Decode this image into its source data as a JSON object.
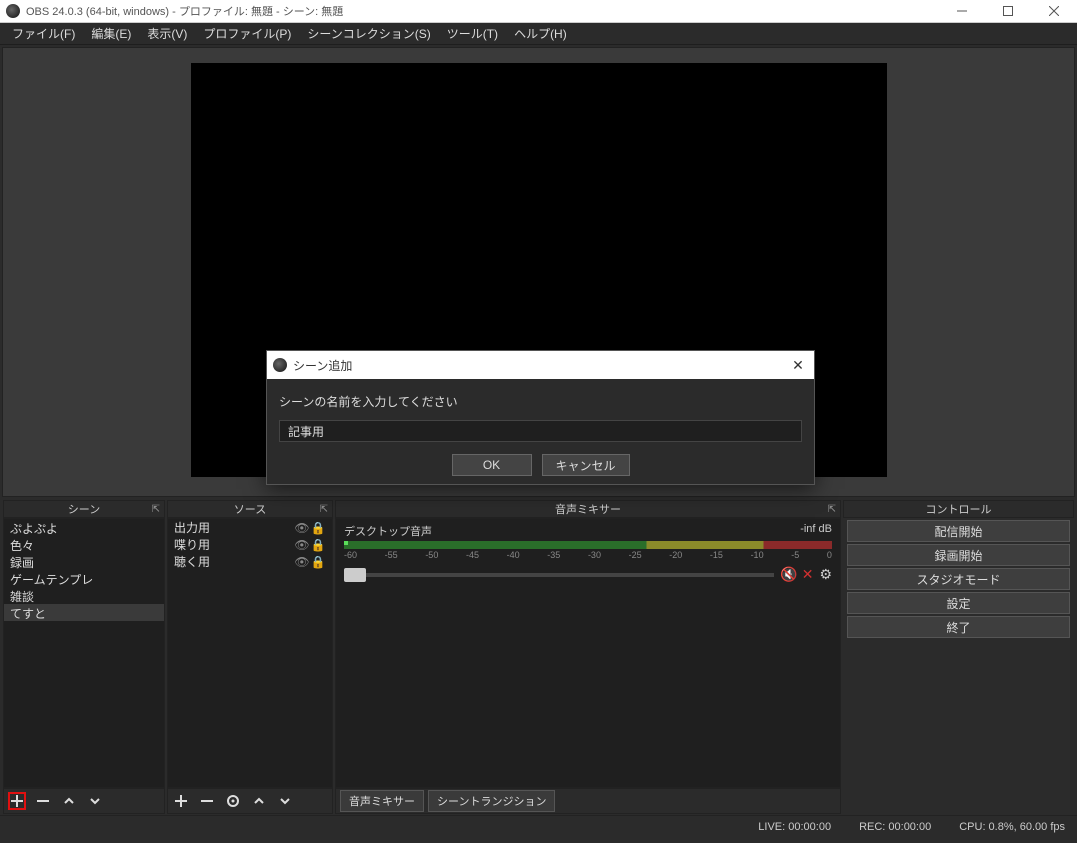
{
  "window": {
    "title": "OBS 24.0.3 (64-bit, windows) - プロファイル: 無題 - シーン: 無題"
  },
  "menu": {
    "file": "ファイル(F)",
    "edit": "編集(E)",
    "view": "表示(V)",
    "profile": "プロファイル(P)",
    "scene_collection": "シーンコレクション(S)",
    "tools": "ツール(T)",
    "help": "ヘルプ(H)"
  },
  "panels": {
    "scenes": {
      "title": "シーン"
    },
    "sources": {
      "title": "ソース"
    },
    "mixer": {
      "title": "音声ミキサー"
    },
    "controls": {
      "title": "コントロール"
    }
  },
  "scenes": {
    "items": [
      "ぷよぷよ",
      "色々",
      "録画",
      "ゲームテンプレ",
      "雑談",
      "てすと"
    ],
    "selected_index": 5
  },
  "sources": {
    "items": [
      {
        "name": "出力用"
      },
      {
        "name": "喋り用"
      },
      {
        "name": "聴く用"
      }
    ]
  },
  "mixer": {
    "track_name": "デスクトップ音声",
    "level": "-inf dB",
    "ticks": [
      "-60",
      "-55",
      "-50",
      "-45",
      "-40",
      "-35",
      "-30",
      "-25",
      "-20",
      "-15",
      "-10",
      "-5",
      "0"
    ],
    "tabs": {
      "mixer": "音声ミキサー",
      "transitions": "シーントランジション"
    }
  },
  "controls": {
    "start_stream": "配信開始",
    "start_record": "録画開始",
    "studio_mode": "スタジオモード",
    "settings": "設定",
    "exit": "終了"
  },
  "status": {
    "live": "LIVE: 00:00:00",
    "rec": "REC: 00:00:00",
    "cpu": "CPU: 0.8%, 60.00 fps"
  },
  "dialog": {
    "title": "シーン追加",
    "prompt": "シーンの名前を入力してください",
    "value": "記事用",
    "ok": "OK",
    "cancel": "キャンセル"
  }
}
